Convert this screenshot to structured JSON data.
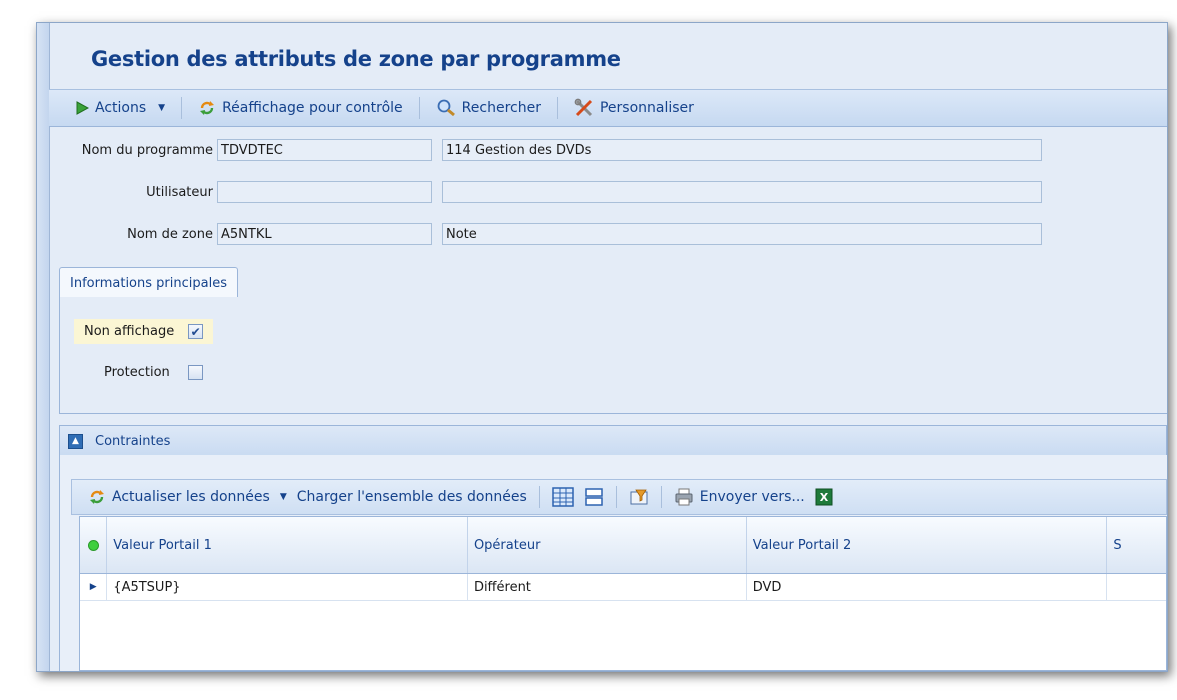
{
  "window_title": "Gestion des attributs de zone par programme",
  "toolbar": {
    "actions": "Actions",
    "refresh": "Réaffichage pour contrôle",
    "search": "Rechercher",
    "customize": "Personnaliser"
  },
  "form": {
    "program": {
      "label": "Nom du programme",
      "code": "TDVDTEC",
      "description": "114 Gestion des DVDs"
    },
    "user": {
      "label": "Utilisateur",
      "code": "",
      "description": ""
    },
    "zone": {
      "label": "Nom de zone",
      "code": "A5NTKL",
      "description": "Note"
    }
  },
  "tab": {
    "label": "Informations principales"
  },
  "options": {
    "non_affichage": {
      "label": "Non affichage",
      "checked": true
    },
    "protection": {
      "label": "Protection",
      "checked": false
    }
  },
  "section": {
    "title": "Contraintes"
  },
  "grid_toolbar": {
    "refresh": "Actualiser les données",
    "load_all": "Charger l'ensemble des données",
    "send_to": "Envoyer vers..."
  },
  "grid": {
    "columns": [
      "Valeur Portail 1",
      "Opérateur",
      "Valeur Portail 2",
      "S"
    ],
    "rows": [
      [
        "{A5TSUP}",
        "Différent",
        "DVD",
        ""
      ]
    ]
  },
  "colors": {
    "title": "#15428b",
    "panel": "#e4ecf7",
    "accent": "#2f6db5"
  }
}
